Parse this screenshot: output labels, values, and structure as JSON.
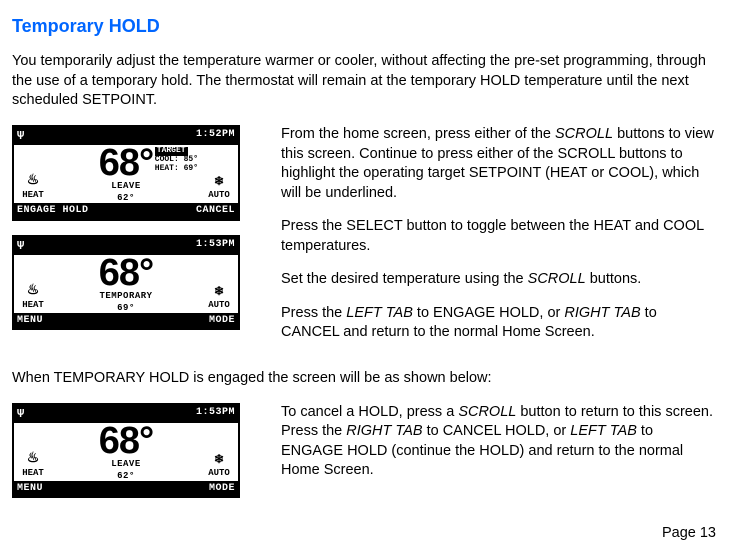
{
  "title": "Temporary HOLD",
  "intro": "You temporarily adjust the temperature warmer or cooler, without affecting the pre-set programming, through the use of a temporary hold.  The thermostat will remain at the temporary HOLD temperature until the next scheduled SETPOINT.",
  "screen1": {
    "time": "1:52PM",
    "left_icon_label": "HEAT",
    "right_icon_label": "AUTO",
    "big_temp": "68°",
    "target_hdr": "TARGET",
    "target_cool": "COOL: 85°",
    "target_heat": "HEAT: 69°",
    "period": "LEAVE",
    "period_val": "62°",
    "bot_left": "ENGAGE HOLD",
    "bot_right": "CANCEL"
  },
  "screen2": {
    "time": "1:53PM",
    "left_icon_label": "HEAT",
    "right_icon_label": "AUTO",
    "big_temp": "68°",
    "period": "TEMPORARY",
    "period_val": "69°",
    "bot_left": "MENU",
    "bot_right": "MODE"
  },
  "screen3": {
    "time": "1:53PM",
    "left_icon_label": "HEAT",
    "right_icon_label": "AUTO",
    "big_temp": "68°",
    "period": "LEAVE",
    "period_val": "62°",
    "bot_left": "MENU",
    "bot_right": "MODE"
  },
  "para1a": "From the home screen, press either of the ",
  "para1b": "SCROLL",
  "para1c": " buttons to view this screen.  Continue to press either of the SCROLL buttons to highlight the operating target SETPOINT (HEAT or COOL), which will be underlined.",
  "para2": "Press the SELECT button to toggle between the HEAT and COOL temperatures.",
  "para3a": "Set the desired temperature using the ",
  "para3b": "SCROLL",
  "para3c": " buttons.",
  "para4a": "Press the ",
  "para4b": "LEFT TAB",
  "para4c": " to ENGAGE HOLD, or ",
  "para4d": "RIGHT TAB",
  "para4e": " to CANCEL and return to the normal Home Screen.",
  "between": "When TEMPORARY HOLD is engaged the screen will be as shown below:",
  "para5a": "To cancel a HOLD, press a ",
  "para5b": "SCROLL",
  "para5c": " button to return to this screen.",
  "para6a": "Press the ",
  "para6b": "RIGHT TAB",
  "para6c": " to CANCEL HOLD, or ",
  "para6d": "LEFT TAB",
  "para6e": " to ENGAGE HOLD (continue the HOLD) and return to the normal Home Screen.",
  "page_number": "Page 13"
}
